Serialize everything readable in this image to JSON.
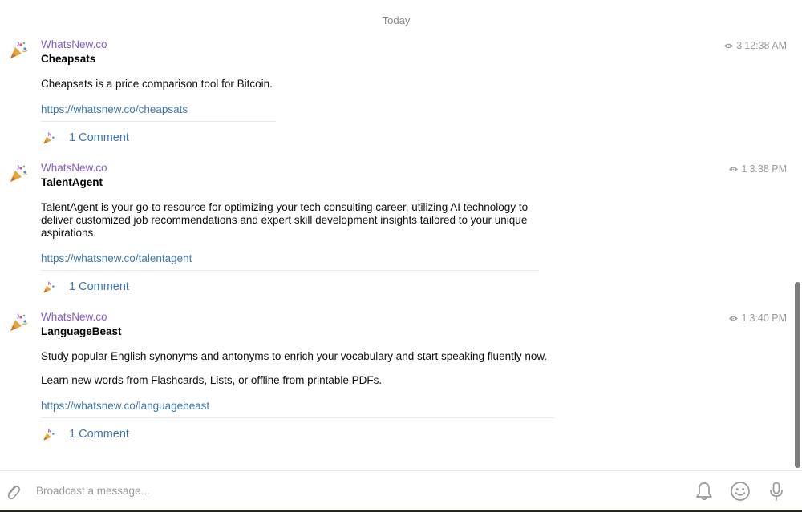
{
  "feed": {
    "date_separator": "Today",
    "messages": [
      {
        "sender": "WhatsNew.co",
        "title": "Cheapsats",
        "paragraphs": [
          "Cheapsats is a price comparison tool for Bitcoin."
        ],
        "link": "https://whatsnew.co/cheapsats",
        "views": "3",
        "time": "12:38 AM",
        "comments_label": "1 Comment"
      },
      {
        "sender": "WhatsNew.co",
        "title": "TalentAgent",
        "paragraphs": [
          "TalentAgent is your go-to resource for optimizing your tech consulting career, utilizing AI technology to deliver customized job recommendations and expert skill development insights tailored to your unique aspirations."
        ],
        "link": "https://whatsnew.co/talentagent",
        "views": "1",
        "time": "3:38 PM",
        "comments_label": "1 Comment"
      },
      {
        "sender": "WhatsNew.co",
        "title": "LanguageBeast",
        "paragraphs": [
          "Study popular English synonyms and antonyms to enrich your vocabulary and start speaking fluently now.",
          "Learn new words from Flashcards, Lists, or offline from printable PDFs."
        ],
        "link": "https://whatsnew.co/languagebeast",
        "views": "1",
        "time": "3:40 PM",
        "comments_label": "1 Comment"
      }
    ]
  },
  "composer": {
    "placeholder": "Broadcast a message..."
  },
  "icons": {
    "avatar": "party-popper-icon",
    "views": "eye-icon",
    "attach": "paperclip-icon",
    "mute": "bell-icon",
    "emoji": "smiley-icon",
    "voice": "microphone-icon"
  },
  "colors": {
    "sender": "#8a5cc6",
    "link": "#3f78b0",
    "meta": "#9a9a9a"
  }
}
